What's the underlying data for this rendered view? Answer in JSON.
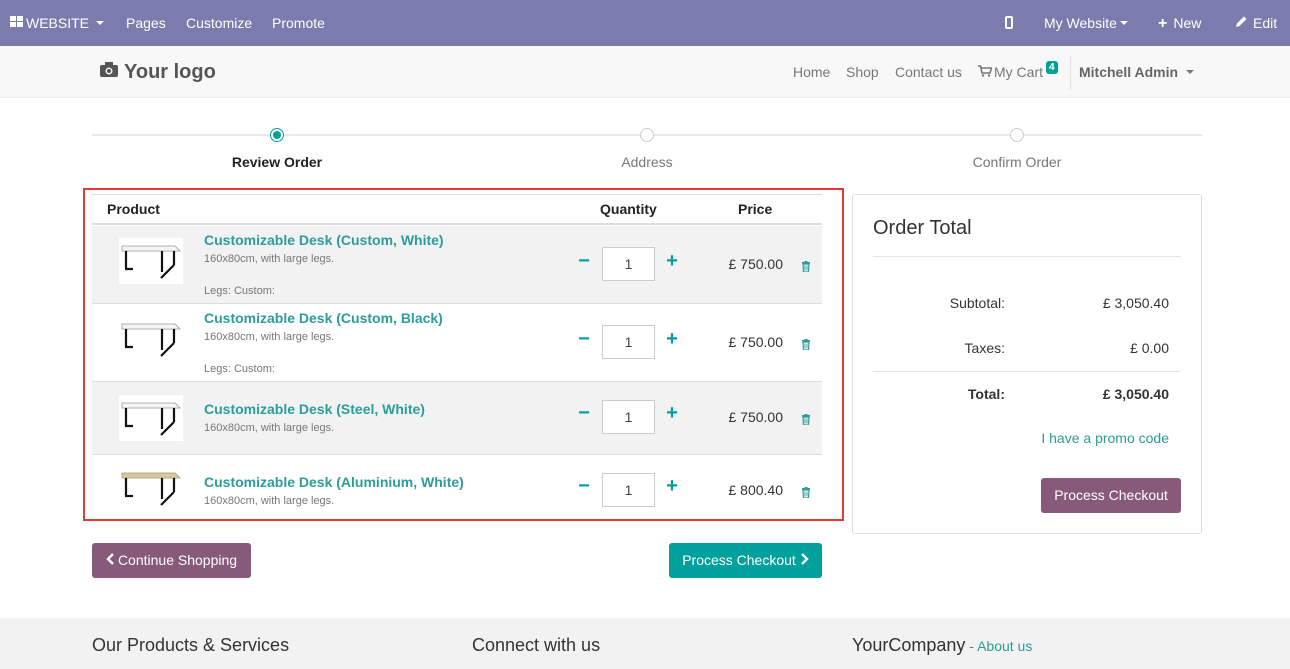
{
  "admin_bar": {
    "website_menu": "WEBSITE",
    "pages": "Pages",
    "customize": "Customize",
    "promote": "Promote",
    "my_website": "My Website",
    "new": "New",
    "edit": "Edit"
  },
  "navbar": {
    "logo_text": "Your logo",
    "links": [
      "Home",
      "Shop",
      "Contact us"
    ],
    "cart_label": "My Cart",
    "cart_count": "4",
    "user": "Mitchell Admin"
  },
  "progress": {
    "steps": [
      "Review Order",
      "Address",
      "Confirm Order"
    ],
    "active_step": 0
  },
  "cart": {
    "headers": {
      "product": "Product",
      "quantity": "Quantity",
      "price": "Price"
    },
    "items": [
      {
        "name": "Customizable Desk (Custom, White)",
        "description": "160x80cm, with large legs.",
        "attribute": "Legs: Custom:",
        "quantity": "1",
        "price": "£ 750.00",
        "top_color": "#f5f5f5"
      },
      {
        "name": "Customizable Desk (Custom, Black)",
        "description": "160x80cm, with large legs.",
        "attribute": "Legs: Custom:",
        "quantity": "1",
        "price": "£ 750.00",
        "top_color": "#f5f5f5"
      },
      {
        "name": "Customizable Desk (Steel, White)",
        "description": "160x80cm, with large legs.",
        "attribute": "",
        "quantity": "1",
        "price": "£ 750.00",
        "top_color": "#f5f5f5"
      },
      {
        "name": "Customizable Desk (Aluminium, White)",
        "description": "160x80cm, with large legs.",
        "attribute": "",
        "quantity": "1",
        "price": "£ 800.40",
        "top_color": "#d9c9a0"
      }
    ]
  },
  "buttons": {
    "continue_shopping": "Continue Shopping",
    "process_checkout": "Process Checkout",
    "process_checkout_side": "Process Checkout"
  },
  "order_total": {
    "title": "Order Total",
    "subtotal_label": "Subtotal:",
    "subtotal_value": "£ 3,050.40",
    "taxes_label": "Taxes:",
    "taxes_value": "£ 0.00",
    "total_label": "Total:",
    "total_value": "£ 3,050.40",
    "promo": "I have a promo code"
  },
  "footer": {
    "col1": "Our Products & Services",
    "col2": "Connect with us",
    "col3_company": "YourCompany",
    "col3_sep": " - ",
    "col3_link": "About us"
  },
  "colors": {
    "admin_bar": "#7c7bad",
    "primary_teal": "#00a09d",
    "secondary_purple": "#875a7b",
    "highlight_border": "#e53935"
  }
}
